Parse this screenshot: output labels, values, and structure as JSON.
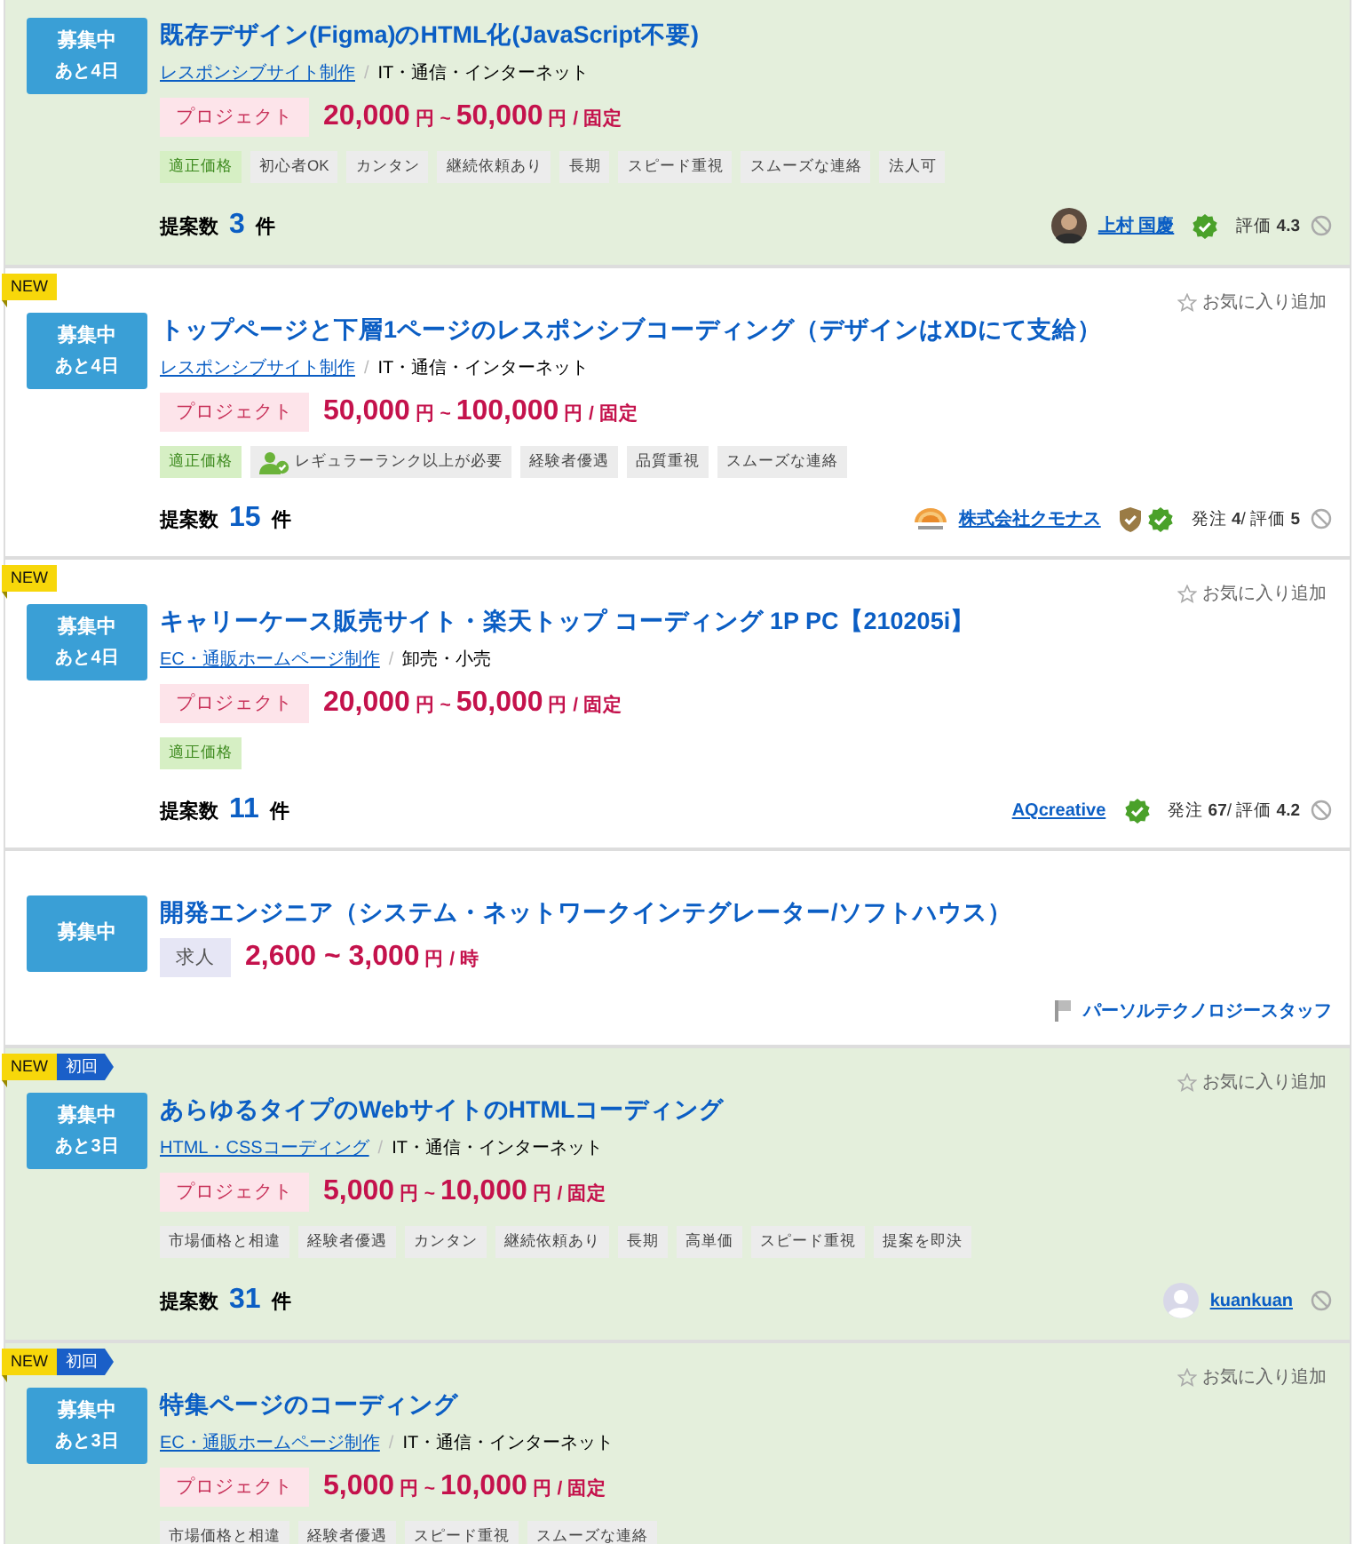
{
  "jobs": [
    {
      "highlight": true,
      "status": {
        "label": "募集中",
        "remaining": "あと4日"
      },
      "title": "既存デザイン(Figma)のHTML化(JavaScript不要)",
      "category": {
        "link": "レスポンシブサイト制作",
        "sep": "/",
        "industry": "IT・通信・インターネット"
      },
      "price": {
        "kind": "project",
        "type": "プロジェクト",
        "amount": "**20,000** 円 ~ **50,000** 円 / 固定"
      },
      "tags": [
        {
          "kind": "fair",
          "label": "適正価格"
        },
        {
          "kind": "plain",
          "label": "初心者OK"
        },
        {
          "kind": "plain",
          "label": "カンタン"
        },
        {
          "kind": "plain",
          "label": "継続依頼あり"
        },
        {
          "kind": "plain",
          "label": "長期"
        },
        {
          "kind": "plain",
          "label": "スピード重視"
        },
        {
          "kind": "plain",
          "label": "スムーズな連絡"
        },
        {
          "kind": "plain",
          "label": "法人可"
        }
      ],
      "proposals": {
        "label": "提案数",
        "count": "3",
        "unit": "件"
      },
      "client": {
        "avatar": {
          "kind": "person"
        },
        "name": "上村 国慶",
        "link": true,
        "certified": false,
        "verified": true,
        "stats": "評価 **4.3**",
        "block": true
      }
    },
    {
      "highlight": false,
      "badges": [
        {
          "kind": "new",
          "label": "NEW"
        }
      ],
      "favorite": "お気に入り追加",
      "status": {
        "label": "募集中",
        "remaining": "あと4日"
      },
      "title": "トップページと下層1ページのレスポンシブコーディング（デザインはXDにて支給）",
      "category": {
        "link": "レスポンシブサイト制作",
        "sep": "/",
        "industry": "IT・通信・インターネット"
      },
      "price": {
        "kind": "project",
        "type": "プロジェクト",
        "amount": "**50,000** 円 ~ **100,000** 円 / 固定"
      },
      "tags": [
        {
          "kind": "fair",
          "label": "適正価格"
        },
        {
          "kind": "rank",
          "label": "レギュラーランク以上が必要"
        },
        {
          "kind": "plain",
          "label": "経験者優遇"
        },
        {
          "kind": "plain",
          "label": "品質重視"
        },
        {
          "kind": "plain",
          "label": "スムーズな連絡"
        }
      ],
      "proposals": {
        "label": "提案数",
        "count": "15",
        "unit": "件"
      },
      "client": {
        "avatar": {
          "kind": "logo"
        },
        "name": "株式会社クモナス",
        "link": true,
        "certified": true,
        "verified": true,
        "stats": "発注 **4**/ 評価 **5**",
        "block": true
      }
    },
    {
      "highlight": false,
      "badges": [
        {
          "kind": "new",
          "label": "NEW"
        }
      ],
      "favorite": "お気に入り追加",
      "status": {
        "label": "募集中",
        "remaining": "あと4日"
      },
      "title": "キャリーケース販売サイト・楽天トップ コーディング 1P PC【210205i】",
      "category": {
        "link": "EC・通販ホームページ制作",
        "sep": "/",
        "industry": "卸売・小売"
      },
      "price": {
        "kind": "project",
        "type": "プロジェクト",
        "amount": "**20,000** 円 ~ **50,000** 円 / 固定"
      },
      "tags": [
        {
          "kind": "fair",
          "label": "適正価格"
        }
      ],
      "proposals": {
        "label": "提案数",
        "count": "11",
        "unit": "件"
      },
      "client": {
        "name": "AQcreative",
        "link": true,
        "certified": false,
        "verified": true,
        "stats": "発注 **67**/ 評価 **4.2**",
        "block": true
      }
    },
    {
      "highlight": false,
      "status": {
        "label": "募集中"
      },
      "title": "開発エンジニア（システム・ネットワークインテグレーター/ソフトハウス）",
      "price": {
        "kind": "job",
        "type": "求人",
        "amount": "**2,600 ~ 3,000** 円 / 時"
      },
      "client": {
        "avatar": {
          "kind": "flag"
        },
        "name": "パーソルテクノロジースタッフ",
        "link": false,
        "certified": false,
        "verified": false,
        "block": false
      }
    },
    {
      "highlight": true,
      "badges": [
        {
          "kind": "new",
          "label": "NEW"
        },
        {
          "kind": "first",
          "label": "初回"
        }
      ],
      "favorite": "お気に入り追加",
      "status": {
        "label": "募集中",
        "remaining": "あと3日"
      },
      "title": "あらゆるタイプのWebサイトのHTMLコーディング",
      "category": {
        "link": "HTML・CSSコーディング",
        "sep": "/",
        "industry": "IT・通信・インターネット"
      },
      "price": {
        "kind": "project",
        "type": "プロジェクト",
        "amount": "**5,000** 円 ~ **10,000** 円 / 固定"
      },
      "tags": [
        {
          "kind": "plain",
          "label": "市場価格と相違"
        },
        {
          "kind": "plain",
          "label": "経験者優遇"
        },
        {
          "kind": "plain",
          "label": "カンタン"
        },
        {
          "kind": "plain",
          "label": "継続依頼あり"
        },
        {
          "kind": "plain",
          "label": "長期"
        },
        {
          "kind": "plain",
          "label": "高単価"
        },
        {
          "kind": "plain",
          "label": "スピード重視"
        },
        {
          "kind": "plain",
          "label": "提案を即決"
        }
      ],
      "proposals": {
        "label": "提案数",
        "count": "31",
        "unit": "件"
      },
      "client": {
        "avatar": {
          "kind": "generic"
        },
        "name": "kuankuan",
        "link": true,
        "certified": false,
        "verified": false,
        "block": true
      }
    },
    {
      "highlight": true,
      "badges": [
        {
          "kind": "new",
          "label": "NEW"
        },
        {
          "kind": "first",
          "label": "初回"
        }
      ],
      "favorite": "お気に入り追加",
      "status": {
        "label": "募集中",
        "remaining": "あと3日"
      },
      "title": "特集ページのコーディング",
      "category": {
        "link": "EC・通販ホームページ制作",
        "sep": "/",
        "industry": "IT・通信・インターネット"
      },
      "price": {
        "kind": "project",
        "type": "プロジェクト",
        "amount": "**5,000** 円 ~ **10,000** 円 / 固定"
      },
      "tags": [
        {
          "kind": "plain",
          "label": "市場価格と相違"
        },
        {
          "kind": "plain",
          "label": "経験者優遇"
        },
        {
          "kind": "plain",
          "label": "スピード重視"
        },
        {
          "kind": "plain",
          "label": "スムーズな連絡"
        }
      ]
    }
  ]
}
